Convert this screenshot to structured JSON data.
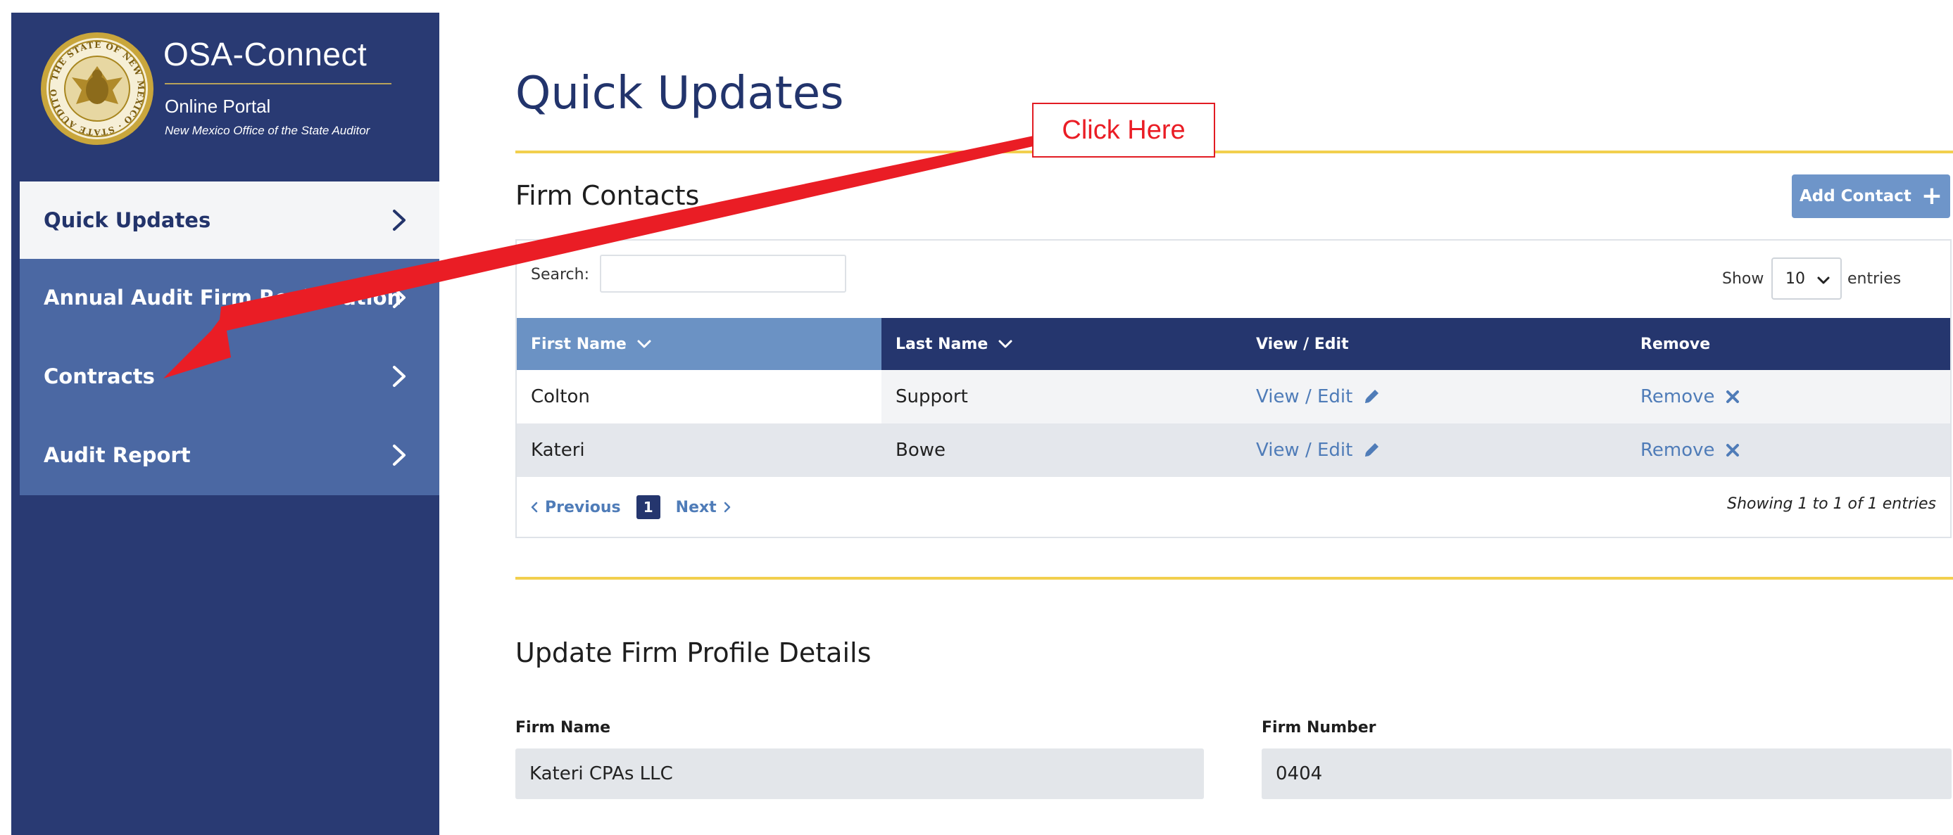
{
  "brand": {
    "title": "OSA-Connect",
    "subtitle": "Online Portal",
    "office": "New Mexico Office of the State Auditor",
    "seal_text": "THE STATE OF NEW MEXICO · STATE AUDITOR"
  },
  "sidebar": {
    "items": [
      {
        "label": "Quick Updates",
        "active": true
      },
      {
        "label": "Annual Audit Firm Registration",
        "active": false
      },
      {
        "label": "Contracts",
        "active": false
      },
      {
        "label": "Audit Report",
        "active": false
      }
    ]
  },
  "main": {
    "page_title": "Quick Updates",
    "contacts": {
      "title": "Firm Contacts",
      "add_button": "Add Contact",
      "search_label": "Search:",
      "search_value": "",
      "show_label": "Show",
      "page_size": "10",
      "entries_label": "entries",
      "columns": [
        "First Name",
        "Last Name",
        "View / Edit",
        "Remove"
      ],
      "rows": [
        {
          "first": "Colton",
          "last": "Support",
          "view": "View / Edit",
          "remove": "Remove"
        },
        {
          "first": "Kateri",
          "last": "Bowe",
          "view": "View / Edit",
          "remove": "Remove"
        }
      ],
      "pager": {
        "previous": "Previous",
        "current": "1",
        "next": "Next"
      },
      "showing": "Showing 1 to 1 of 1 entries"
    },
    "profile": {
      "title": "Update Firm Profile Details",
      "firm_name_label": "Firm Name",
      "firm_name_value": "Kateri CPAs LLC",
      "firm_number_label": "Firm Number",
      "firm_number_value": "0404"
    }
  },
  "annotation": {
    "callout": "Click Here",
    "color": "#ea1d25"
  },
  "colors": {
    "sidebar_bg": "#293a73",
    "nav_bg": "#4b68a3",
    "header_dark": "#25366e",
    "accent_gold": "#f2cf4e",
    "link_blue": "#4f7cb8"
  }
}
